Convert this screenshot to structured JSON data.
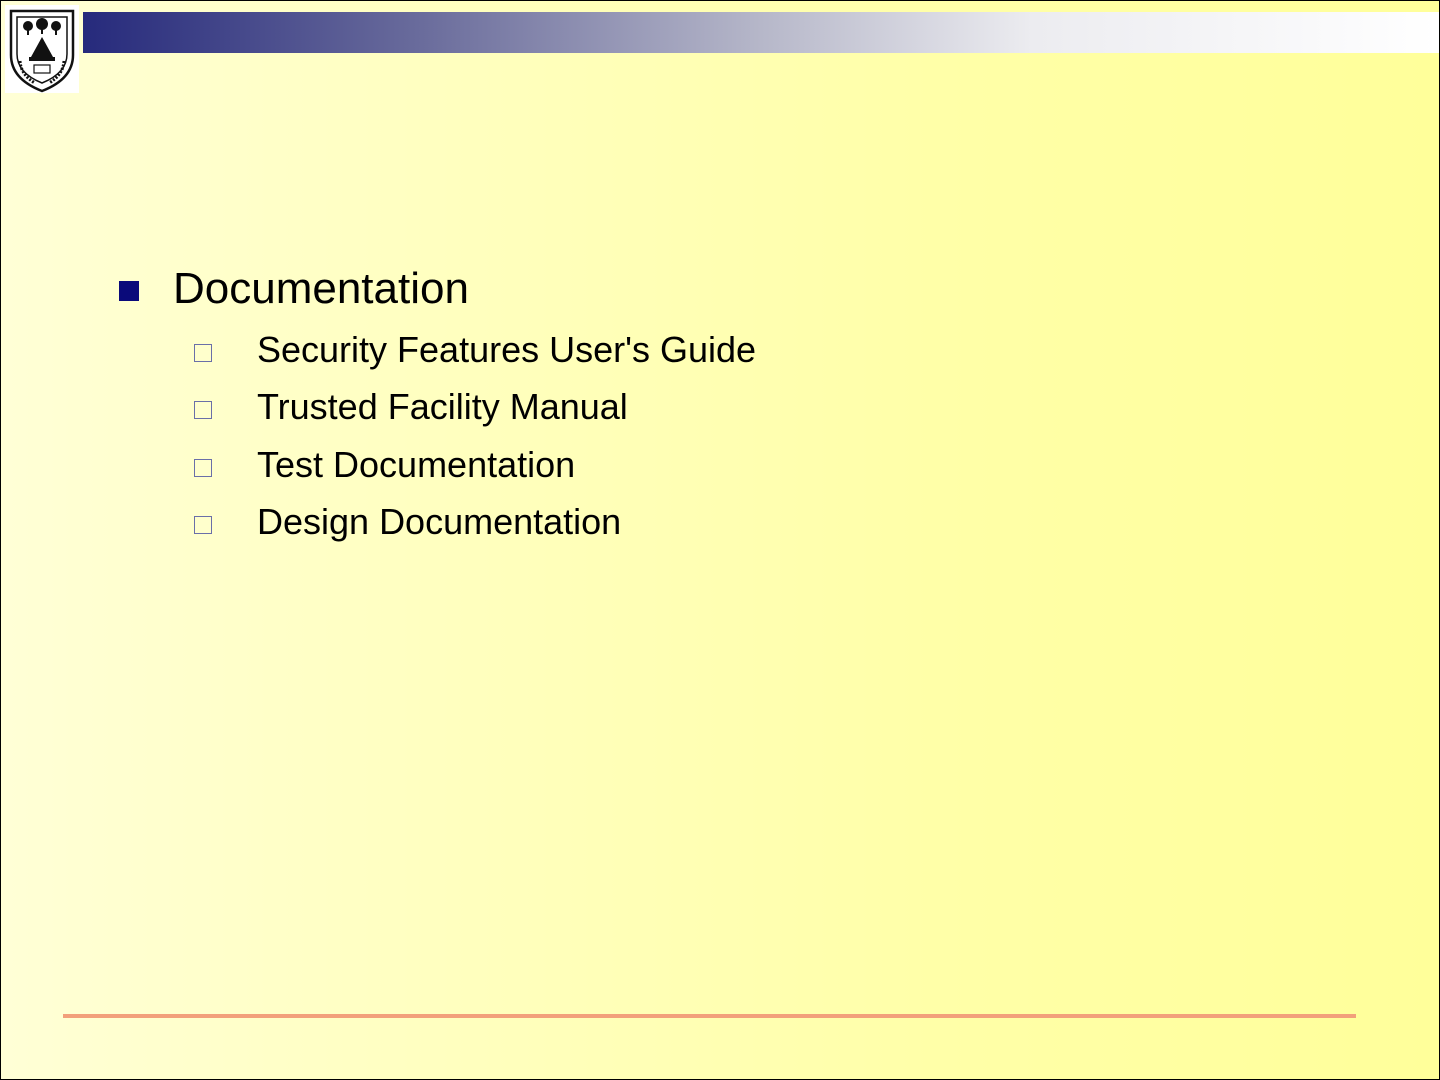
{
  "header": {
    "logo_icon": "university-crest-icon",
    "bar_gradient": [
      "#262a7c",
      "#ffffff"
    ]
  },
  "content": {
    "heading": "Documentation",
    "items": [
      "Security Features User's Guide",
      "Trusted Facility Manual",
      "Test Documentation",
      "Design Documentation"
    ]
  },
  "colors": {
    "background": "#ffffc0",
    "bullet": "#0a0a7a",
    "footer_line": "#f2a07b"
  }
}
